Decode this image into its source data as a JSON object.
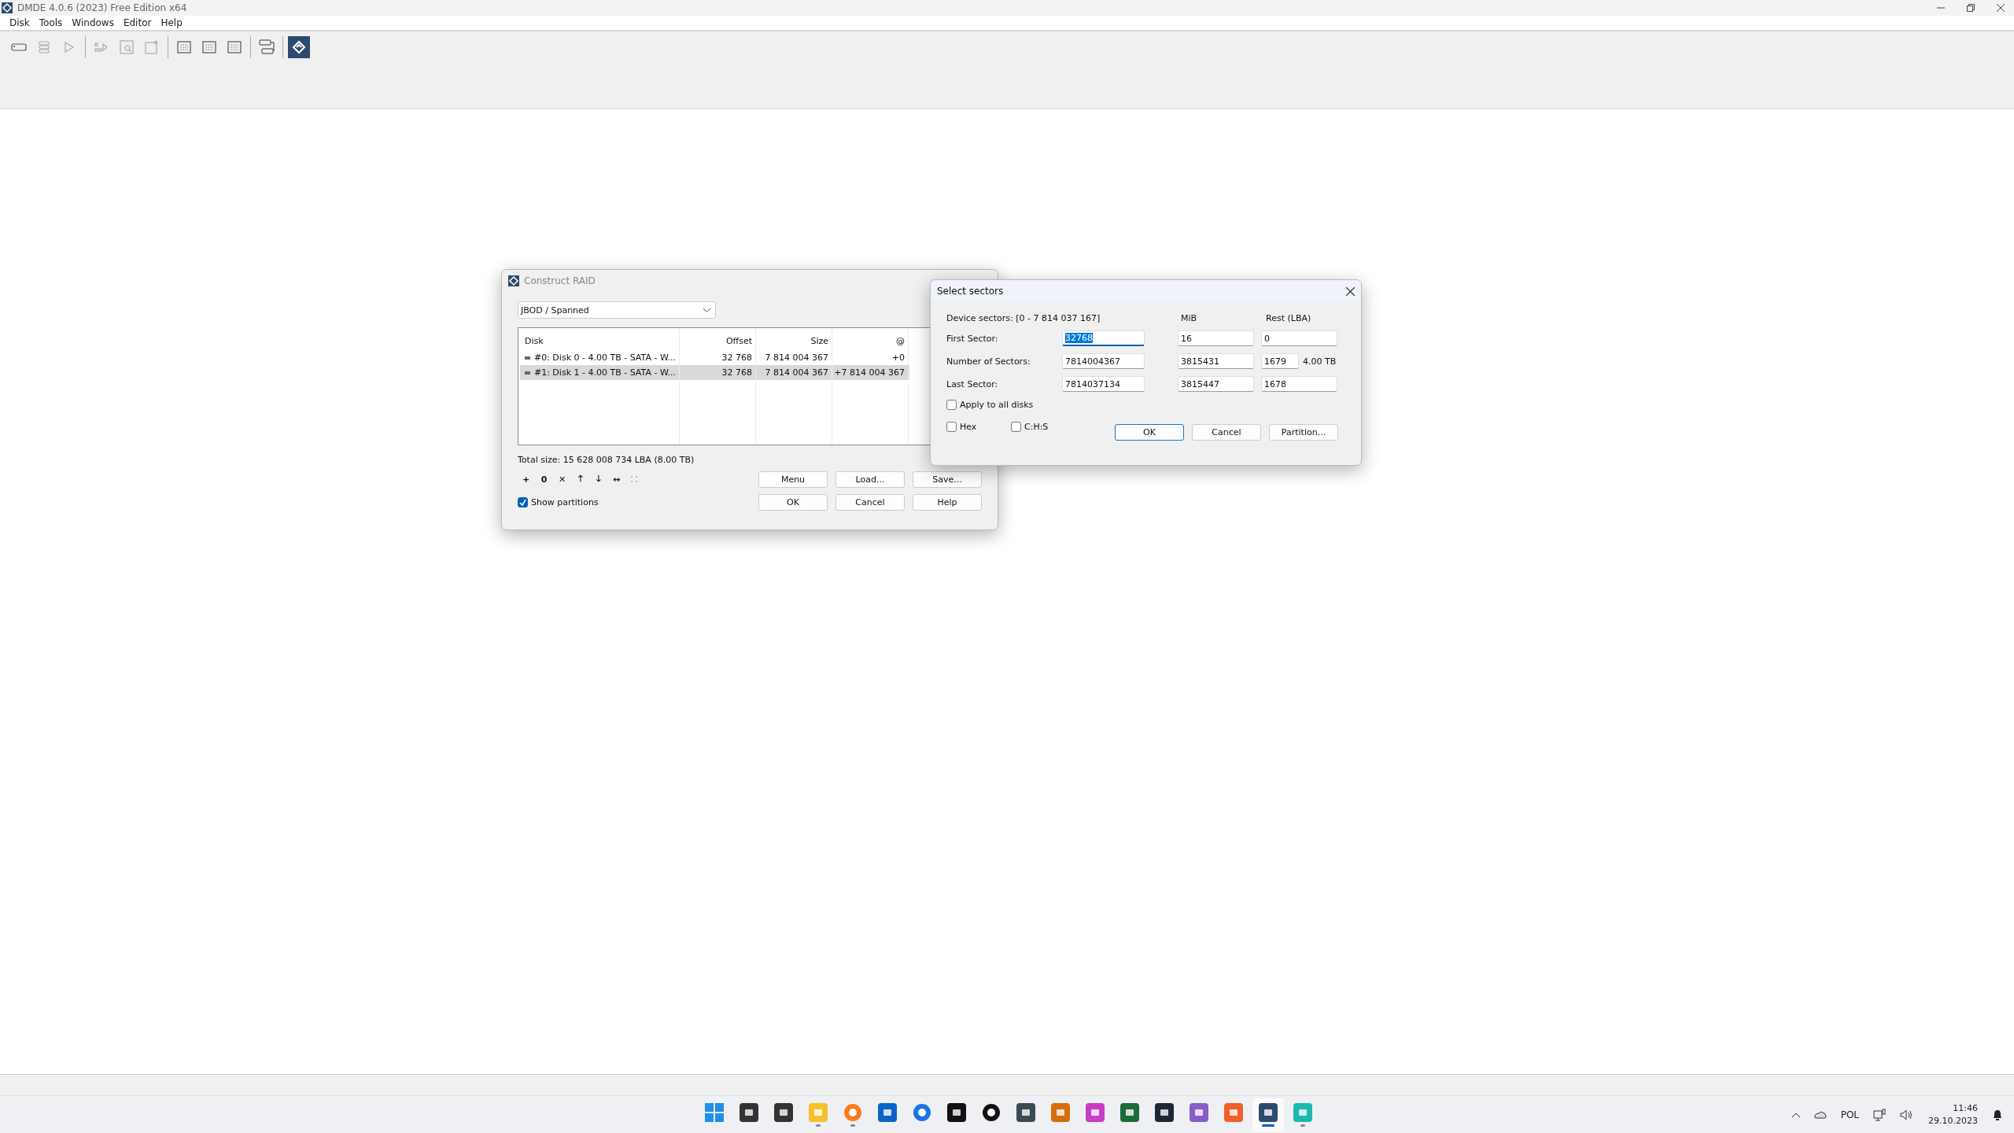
{
  "window": {
    "title": "DMDE 4.0.6 (2023) Free Edition x64"
  },
  "menu": [
    "Disk",
    "Tools",
    "Windows",
    "Editor",
    "Help"
  ],
  "toolbar_groups": [
    [
      {
        "disabled": false,
        "selected": false
      },
      {
        "disabled": true,
        "selected": false
      },
      {
        "disabled": true,
        "selected": false
      }
    ],
    [
      {
        "disabled": true,
        "selected": false
      },
      {
        "disabled": true,
        "selected": false
      },
      {
        "disabled": true,
        "selected": false
      }
    ],
    [
      {
        "disabled": false,
        "selected": false
      },
      {
        "disabled": false,
        "selected": false
      },
      {
        "disabled": false,
        "selected": false
      }
    ],
    [
      {
        "disabled": false,
        "selected": false
      }
    ],
    [
      {
        "disabled": false,
        "selected": true
      }
    ]
  ],
  "construct_raid": {
    "title": "Construct RAID",
    "active": false,
    "raid_type": "JBOD / Spanned",
    "columns": [
      "Disk",
      "Offset",
      "Size",
      "@"
    ],
    "rows": [
      {
        "cells": [
          "#0: Disk 0 - 4.00 TB - SATA - W...",
          "32 768",
          "7 814 004 367",
          "+0"
        ],
        "selected": false
      },
      {
        "cells": [
          "#1: Disk 1 - 4.00 TB - SATA - W...",
          "32 768",
          "7 814 004 367",
          "+7 814 004 367"
        ],
        "selected": true
      }
    ],
    "total_size": "Total size: 15 628 008 734 LBA (8.00 TB)",
    "edit_tools": [
      {
        "kind": "text",
        "symbol": "+",
        "disabled": false
      },
      {
        "kind": "text",
        "symbol": "0",
        "disabled": false
      },
      {
        "kind": "text",
        "symbol": "✕",
        "disabled": false
      },
      {
        "kind": "text",
        "symbol": "🡑",
        "disabled": false
      },
      {
        "kind": "text",
        "symbol": "🡓",
        "disabled": false
      },
      {
        "kind": "text",
        "symbol": "↔",
        "disabled": false
      },
      {
        "kind": "dots",
        "disabled": true
      }
    ],
    "buttons_top": [
      "Menu",
      "Load...",
      "Save..."
    ],
    "buttons_bottom": [
      "OK",
      "Cancel",
      "Help"
    ],
    "show_partitions": {
      "label": "Show partitions",
      "checked": true
    }
  },
  "select_sectors": {
    "title": "Select sectors",
    "active": true,
    "device_sectors": "Device sectors: [0 - 7 814 037 167]",
    "headers": [
      "MiB",
      "Rest (LBA)"
    ],
    "rows": [
      {
        "label": "First Sector:",
        "sectors": "32768",
        "mib": "16",
        "rest": "0",
        "focused": true
      },
      {
        "label": "Number of Sectors:",
        "sectors": "7814004367",
        "mib": "3815431",
        "rest": "1679",
        "size": "4.00 TB",
        "focused": false
      },
      {
        "label": "Last Sector:",
        "sectors": "7814037134",
        "mib": "3815447",
        "rest": "1678",
        "focused": false
      }
    ],
    "apply_all": {
      "label": "Apply to all disks",
      "checked": false
    },
    "hex": {
      "label": "Hex",
      "checked": false
    },
    "chs": {
      "label": "C:H:S",
      "checked": false
    },
    "buttons": [
      {
        "label": "OK",
        "default": true
      },
      {
        "label": "Cancel",
        "default": false
      },
      {
        "label": "Partition...",
        "default": false
      }
    ]
  },
  "taskbar": {
    "apps": [
      {
        "running": false,
        "selected": false
      },
      {
        "running": false,
        "selected": false
      },
      {
        "running": false,
        "selected": false
      },
      {
        "running": true,
        "selected": false
      },
      {
        "running": true,
        "selected": false
      },
      {
        "running": false,
        "selected": false
      },
      {
        "running": false,
        "selected": false
      },
      {
        "running": false,
        "selected": false
      },
      {
        "running": false,
        "selected": false
      },
      {
        "running": false,
        "selected": false
      },
      {
        "running": false,
        "selected": false
      },
      {
        "running": false,
        "selected": false
      },
      {
        "running": false,
        "selected": false
      },
      {
        "running": false,
        "selected": false
      },
      {
        "running": false,
        "selected": false
      },
      {
        "running": false,
        "selected": false
      },
      {
        "running": true,
        "selected": true
      },
      {
        "running": true,
        "selected": false
      }
    ],
    "language": "POL",
    "time": "11:46",
    "date": "29.10.2023"
  }
}
